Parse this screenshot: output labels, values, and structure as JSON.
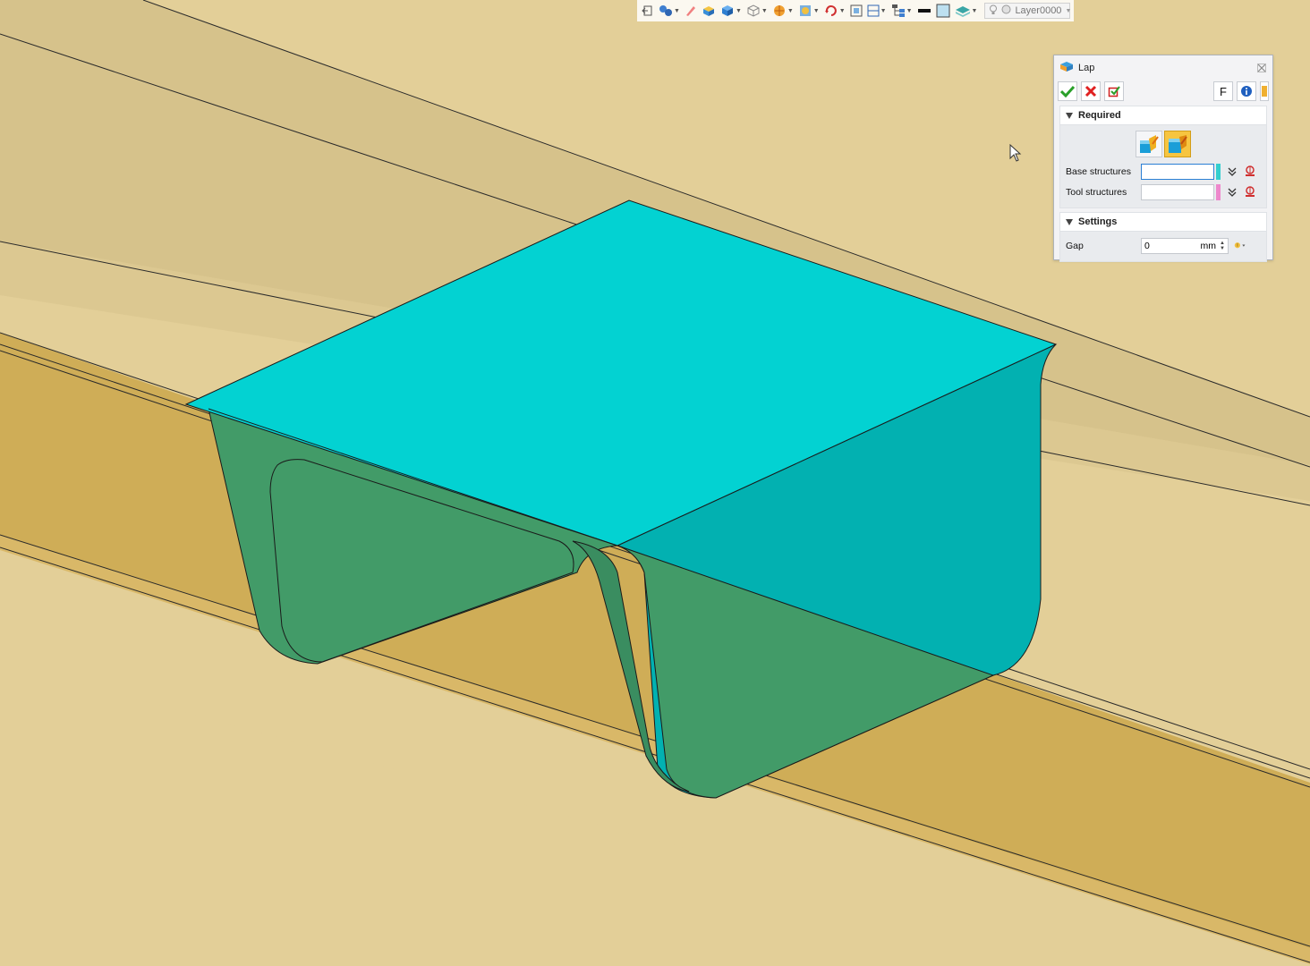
{
  "toolbar": {
    "icons": [
      "exit-icon",
      "assembly-icon",
      "pencil-icon",
      "solid-icon",
      "box-icon",
      "wireframe-cube-icon",
      "render-sphere-icon",
      "render-mode-icon",
      "rotate-view-icon",
      "zoom-fit-icon",
      "section-view-icon",
      "hierarchy-icon",
      "line-style-icon",
      "color-swatch-icon",
      "layer-display-icon"
    ],
    "layer": "Layer0000"
  },
  "lap": {
    "title": "Lap",
    "f_label": "F",
    "required_label": "Required",
    "base_structures_label": "Base structures",
    "base_structures_value": "",
    "base_color": "#33cfcf",
    "tool_structures_label": "Tool structures",
    "tool_structures_value": "",
    "tool_color": "#ee88cc",
    "settings_label": "Settings",
    "gap_label": "Gap",
    "gap_value": "0",
    "gap_unit": "mm"
  },
  "colors": {
    "beam_light": "#e3cf98",
    "beam_mid": "#d8c48e",
    "beam_dark": "#cfae57",
    "plate_cyan": "#03d2d2",
    "plate_wall": "#429b68",
    "accent": "#f7c540"
  }
}
